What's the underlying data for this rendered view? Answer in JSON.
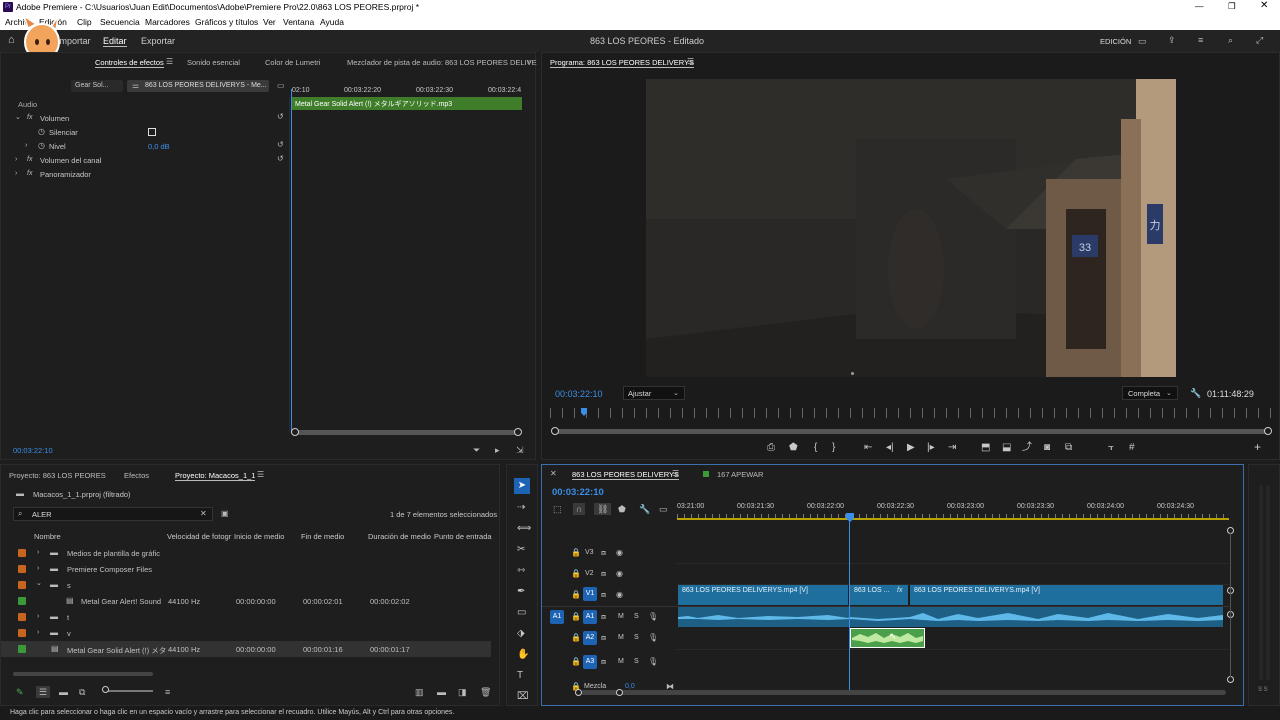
{
  "window": {
    "title": "Adobe Premiere - C:\\Usuarios\\Juan Edit\\Documentos\\Adobe\\Premiere Pro\\22.0\\863 LOS PEORES.prproj *",
    "app_badge": "Pr"
  },
  "menu": [
    "Archivo",
    "Edición",
    "Clip",
    "Secuencia",
    "Marcadores",
    "Gráficos y títulos",
    "Ver",
    "Ventana",
    "Ayuda"
  ],
  "workspace": {
    "tabs": [
      "Importar",
      "Editar",
      "Exportar"
    ],
    "active": "Editar",
    "center": "863 LOS PEORES - Editado",
    "mode": "EDICIÓN"
  },
  "effects": {
    "tabs": [
      "Controles de efectos",
      "Sonido esencial",
      "Color de Lumetri",
      "Mezclador de pista de audio: 863 LOS PEORES DELIVE"
    ],
    "source_label": "Gear Sol...",
    "seq_label": "863 LOS PEORES DELIVERYS - Me...",
    "section": "Audio",
    "rows": [
      {
        "label": "Volumen",
        "value": ""
      },
      {
        "label": "Silenciar",
        "value": ""
      },
      {
        "label": "Nivel",
        "value": "0,0 dB"
      },
      {
        "label": "Volumen del canal",
        "value": ""
      },
      {
        "label": "Panoramizador",
        "value": ""
      }
    ],
    "ruler": [
      "02:10",
      "00:03:22:20",
      "00:03:22:30",
      "00:03:22:4"
    ],
    "clip": "Metal Gear Solid Alert (!) メタルギアソリッド.mp3",
    "timecode": "00:03:22:10"
  },
  "program": {
    "tab": "Programa: 863 LOS PEORES DELIVERYS",
    "timecode": "00:03:22:10",
    "fit": "Ajustar",
    "quality": "Completa",
    "duration": "01:11:48:29",
    "sign1": "33",
    "sign2": "力"
  },
  "project": {
    "tabs": [
      "Proyecto: 863 LOS PEORES",
      "Efectos",
      "Proyecto: Macacos_1_1"
    ],
    "file": "Macacos_1_1.prproj (filtrado)",
    "search": "ALER",
    "status": "1 de 7 elementos seleccionados",
    "columns": [
      "Nombre",
      "Velocidad de fotogr",
      "Inicio de medio",
      "Fin de medio",
      "Duración de medio",
      "Punto de entrada"
    ],
    "rows": [
      {
        "name": "Medios de plantilla de gráfic",
        "fps": "",
        "start": "",
        "end": "",
        "dur": "",
        "color": "#c8641e"
      },
      {
        "name": "Premiere Composer Files",
        "fps": "",
        "start": "",
        "end": "",
        "dur": "",
        "color": "#c8641e"
      },
      {
        "name": "s",
        "fps": "",
        "start": "",
        "end": "",
        "dur": "",
        "color": "#c8641e"
      },
      {
        "name": "Metal Gear Alert! Sound",
        "fps": "44100 Hz",
        "start": "00:00:00:00",
        "end": "00:00:02:01",
        "dur": "00:00:02:02",
        "color": "#3a9a3a"
      },
      {
        "name": "t",
        "fps": "",
        "start": "",
        "end": "",
        "dur": "",
        "color": "#c8641e"
      },
      {
        "name": "v",
        "fps": "",
        "start": "",
        "end": "",
        "dur": "",
        "color": "#c8641e"
      },
      {
        "name": "Metal Gear Solid Alert (!) メタ",
        "fps": "44100 Hz",
        "start": "00:00:00:00",
        "end": "00:00:01:16",
        "dur": "00:00:01:17",
        "color": "#3a9a3a"
      }
    ]
  },
  "timeline": {
    "tabs": [
      "863 LOS PEORES DELIVERYS",
      "167 APEWAR"
    ],
    "timecode": "00:03:22:10",
    "ruler": [
      "03:21:00",
      "00:03:21:30",
      "00:03:22:00",
      "00:03:22:30",
      "00:03:23:00",
      "00:03:23:30",
      "00:03:24:00",
      "00:03:24:30"
    ],
    "tracks": [
      "V3",
      "V2",
      "V1",
      "A1",
      "A2",
      "A3"
    ],
    "src_a1": "A1",
    "mix": "Mezcla",
    "mix_val": "0,0",
    "clips": [
      "863 LOS PEORES DELIVERYS.mp4 [V]",
      "863 LOS ...",
      "863 LOS PEORES DELIVERYS.mp4 [V]"
    ],
    "ms": [
      "M",
      "S"
    ]
  },
  "statusbar": "Haga clic para seleccionar o haga clic en un espacio vacío y arrastre para seleccionar el recuadro. Utilice Mayús, Alt y Ctrl para otras opciones.",
  "colors": {
    "accent": "#3b8ee8",
    "video_clip": "#1f6f9e",
    "audio_clip": "#4aa04a",
    "track_label": "#1e64b4"
  }
}
